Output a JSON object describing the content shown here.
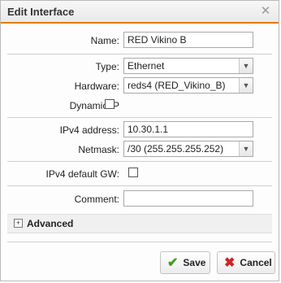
{
  "dialog": {
    "title": "Edit Interface",
    "close_icon": "close-icon"
  },
  "form": {
    "name": {
      "label": "Name:",
      "value": "RED Vikino B"
    },
    "type": {
      "label": "Type:",
      "value": "Ethernet"
    },
    "hardware": {
      "label": "Hardware:",
      "value": "reds4 (RED_Vikino_B)"
    },
    "dynamic_ip": {
      "label": "Dynamic IP",
      "checked": false
    },
    "ipv4_address": {
      "label": "IPv4 address:",
      "value": "10.30.1.1"
    },
    "netmask": {
      "label": "Netmask:",
      "value": "/30 (255.255.255.252)"
    },
    "ipv4_default_gw": {
      "label": "IPv4 default GW:",
      "checked": false
    },
    "comment": {
      "label": "Comment:",
      "value": ""
    }
  },
  "advanced": {
    "label": "Advanced",
    "toggle_icon": "plus-expand-icon"
  },
  "buttons": {
    "save": {
      "label": "Save",
      "icon": "checkmark-icon"
    },
    "cancel": {
      "label": "Cancel",
      "icon": "x-cross-icon"
    }
  },
  "colors": {
    "title_underline": "#e07b12",
    "save_icon": "#3e9e1f",
    "cancel_icon": "#d22222"
  }
}
